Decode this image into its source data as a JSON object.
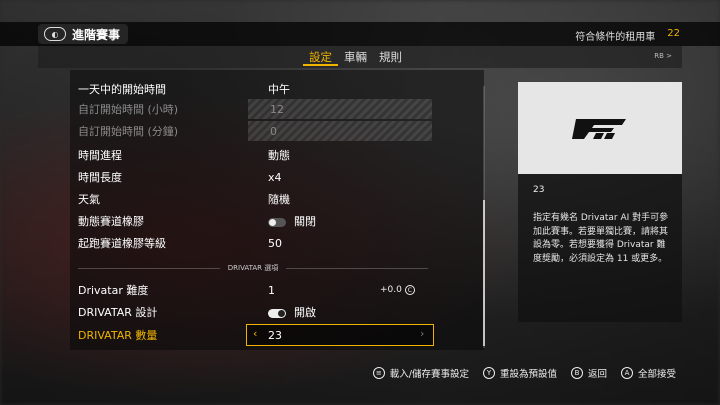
{
  "header": {
    "title": "進階賽事",
    "icon": "forza-controller-icon",
    "eligible_cars_label": "符合條件的租用車",
    "eligible_cars_count": "22"
  },
  "tabs": [
    {
      "label": "設定",
      "active": true
    },
    {
      "label": "車輛",
      "active": false
    },
    {
      "label": "規則",
      "active": false
    }
  ],
  "rb_label": "RB",
  "settings": [
    {
      "label": "一天中的開始時間",
      "value": "中午",
      "disabled": false
    },
    {
      "label": "自訂開始時間 (小時)",
      "value": "12",
      "disabled": true
    },
    {
      "label": "自訂開始時間 (分鐘)",
      "value": "0",
      "disabled": true
    },
    {
      "label": "時間進程",
      "value": "動態",
      "disabled": false
    },
    {
      "label": "時間長度",
      "value": "x4",
      "disabled": false
    },
    {
      "label": "天氣",
      "value": "隨機",
      "disabled": false
    },
    {
      "label": "動態賽道橡膠",
      "value": "關閉",
      "disabled": false,
      "toggle": "off"
    },
    {
      "label": "起跑賽道橡膠等級",
      "value": "50",
      "disabled": false
    }
  ],
  "section": {
    "label": "DRIVATAR 選項"
  },
  "drivatar": [
    {
      "label": "Drivatar 難度",
      "value": "1",
      "extra": "+0.0",
      "extra_icon": "credits-icon"
    },
    {
      "label": "DRIVATAR 設計",
      "value": "開啟",
      "toggle": "on"
    },
    {
      "label": "DRIVATAR 數量",
      "value": "23",
      "selected": true
    }
  ],
  "info_panel": {
    "title": "23",
    "description": "指定有幾名 Drivatar AI 對手可參加此賽事。若要單獨比賽，請將其設為零。若想要獲得 Drivatar 難度獎勵，必須設定為 11 或更多。",
    "logo": "forza-logo-icon"
  },
  "bottom_actions": [
    {
      "button": "≡",
      "label": "載入/儲存賽事設定",
      "icon": "menu-button-icon"
    },
    {
      "button": "Y",
      "label": "重設為預設值",
      "icon": "y-button-icon"
    },
    {
      "button": "B",
      "label": "返回",
      "icon": "b-button-icon"
    },
    {
      "button": "A",
      "label": "全部接受",
      "icon": "a-button-icon"
    }
  ],
  "colors": {
    "accent": "#f0b400"
  }
}
